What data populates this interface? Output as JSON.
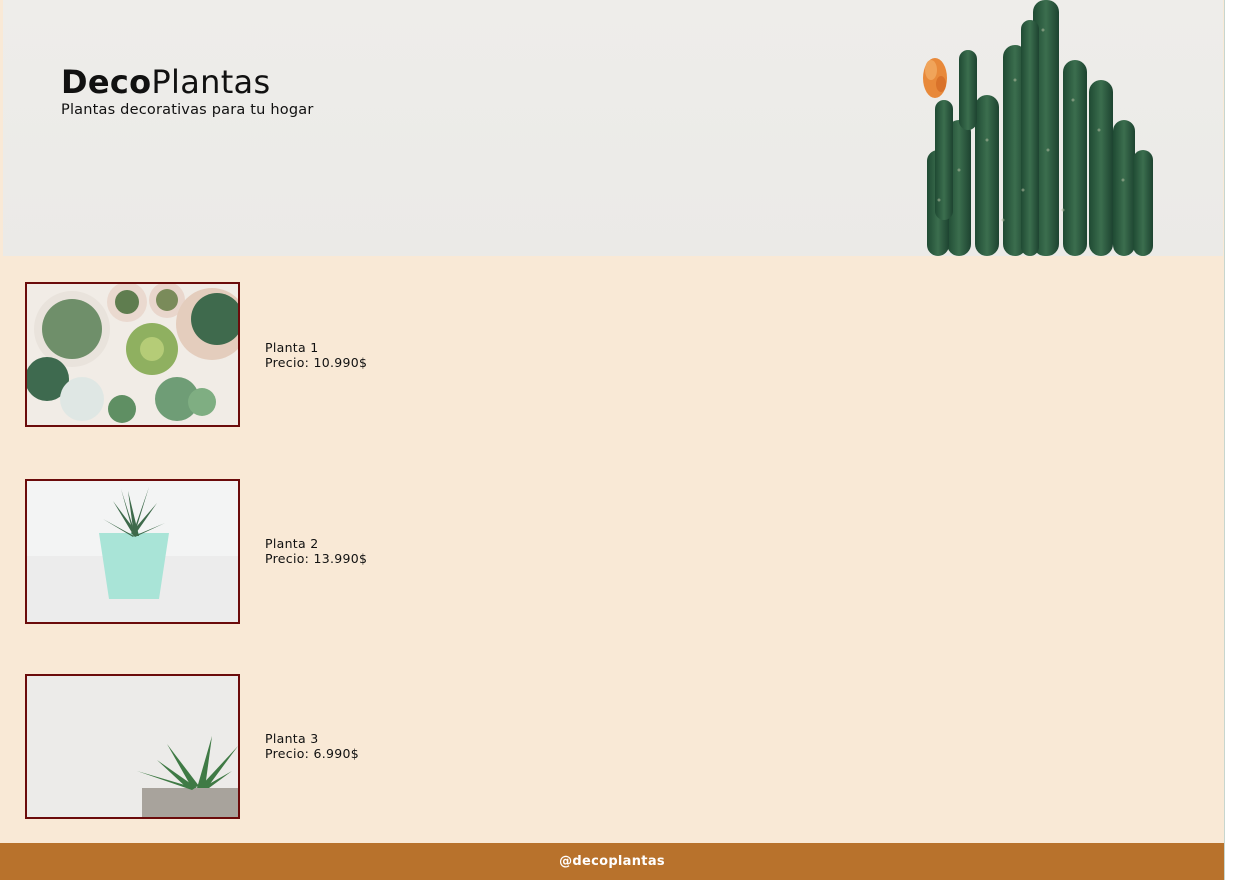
{
  "header": {
    "brand_bold": "Deco",
    "brand_light": "Plantas",
    "tagline": "Plantas decorativas para tu hogar"
  },
  "products": [
    {
      "name": "Planta 1",
      "price": "Precio: 10.990$",
      "image": "succulents-top-view-image"
    },
    {
      "name": "Planta 2",
      "price": "Precio: 13.990$",
      "image": "succulent-mint-pot-image"
    },
    {
      "name": "Planta 3",
      "price": "Precio: 6.990$",
      "image": "succulent-grey-pot-image"
    }
  ],
  "footer": {
    "handle": "@decoplantas"
  },
  "colors": {
    "page_background": "#f9e9d6",
    "thumbnail_border": "#6b0b0b",
    "footer_background": "#b8722c"
  }
}
